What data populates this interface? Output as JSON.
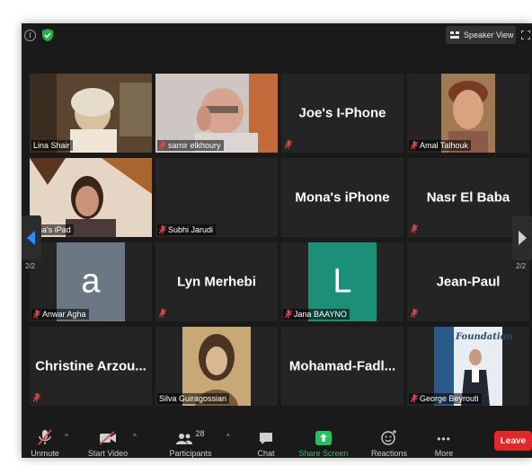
{
  "top_bar": {
    "speaker_view_label": "Speaker View"
  },
  "pagination": {
    "left_page": "2/2",
    "right_page": "2/2"
  },
  "participants": [
    {
      "label": "Lina Shair",
      "display_name": ""
    },
    {
      "label": "samir elkhoury",
      "display_name": ""
    },
    {
      "label": "",
      "display_name": "Joe's I-Phone"
    },
    {
      "label": "Amal Talhouk",
      "display_name": ""
    },
    {
      "label": "ana's iPad",
      "display_name": ""
    },
    {
      "label": "Subhi Jarudi",
      "display_name": ""
    },
    {
      "label": "",
      "display_name": "Mona's iPhone"
    },
    {
      "label": "",
      "display_name": "Nasr El Baba"
    },
    {
      "label": "Anwar Agha",
      "display_name": "",
      "avatar_letter": "a"
    },
    {
      "label": "",
      "display_name": "Lyn Merhebi"
    },
    {
      "label": "Jana BAAYNO",
      "display_name": "",
      "avatar_letter": "L"
    },
    {
      "label": "",
      "display_name": "Jean-Paul"
    },
    {
      "label": "",
      "display_name": "Christine  Arzou..."
    },
    {
      "label": "Silva Guiragossian",
      "display_name": ""
    },
    {
      "label": "",
      "display_name": "Mohamad-Fadl..."
    },
    {
      "label": "George Beyrouti",
      "display_name": "",
      "banner_text": "Foundation"
    }
  ],
  "toolbar": {
    "unmute_label": "Unmute",
    "start_video_label": "Start Video",
    "participants_label": "Participants",
    "participants_count": "28",
    "chat_label": "Chat",
    "share_screen_label": "Share Screen",
    "reactions_label": "Reactions",
    "more_label": "More",
    "leave_label": "Leave",
    "more_glyph": "•••"
  },
  "colors": {
    "background": "#1a1a1a",
    "tile": "#242424",
    "muted_red": "#e04848",
    "share_green": "#22c35e",
    "leave_red": "#e02828",
    "avatar_gray": "#6b7883",
    "avatar_teal": "#1b8f78"
  }
}
